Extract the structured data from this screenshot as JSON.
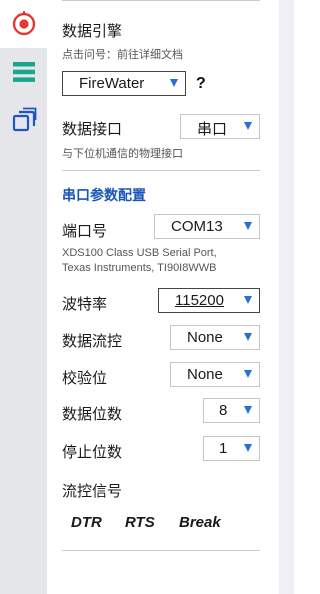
{
  "sidebar": {
    "items": [
      {
        "icon": "record-target-icon",
        "color": "#e53935",
        "active": true
      },
      {
        "icon": "menu-lines-icon",
        "color": "#1aa58f",
        "active": false
      },
      {
        "icon": "windows-stack-icon",
        "color": "#1f55c9",
        "active": false
      }
    ]
  },
  "data_engine": {
    "title": "数据引擎",
    "hint": "点击问号：前往详细文档",
    "selected": "FireWater",
    "help": "?"
  },
  "data_interface": {
    "label": "数据接口",
    "selected": "串口",
    "hint": "与下位机通信的物理接口"
  },
  "serial": {
    "section_title": "串口参数配置",
    "port": {
      "label": "端口号",
      "selected": "COM13",
      "desc_line1": "XDS100 Class USB Serial Port,",
      "desc_line2": "Texas Instruments, TI90I8WWB"
    },
    "baud": {
      "label": "波特率",
      "selected": "115200"
    },
    "flow_control": {
      "label": "数据流控",
      "selected": "None"
    },
    "parity": {
      "label": "校验位",
      "selected": "None"
    },
    "data_bits": {
      "label": "数据位数",
      "selected": "8"
    },
    "stop_bits": {
      "label": "停止位数",
      "selected": "1"
    },
    "flow_signals": {
      "label": "流控信号",
      "buttons": [
        "DTR",
        "RTS",
        "Break"
      ]
    }
  },
  "colors": {
    "accent": "#2a6fd6",
    "section_title": "#1a56b8"
  }
}
